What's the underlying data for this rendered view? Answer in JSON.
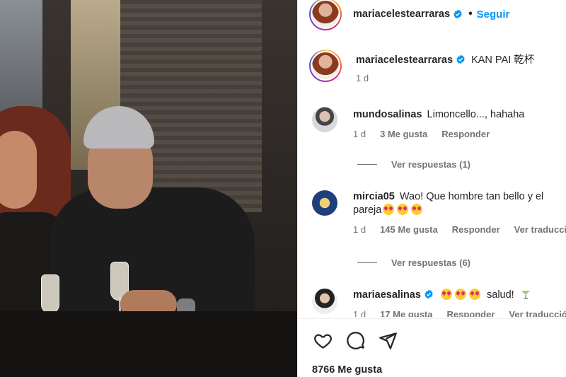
{
  "post": {
    "author": "mariacelestearraras",
    "follow_label": "Seguir",
    "dot": "•",
    "caption": {
      "username": "mariacelestearraras",
      "text": "KAN PAI 乾杯",
      "time": "1 d"
    },
    "likes": "8766 Me gusta"
  },
  "comments": [
    {
      "username": "mundosalinas",
      "text": "Limoncello..., hahaha",
      "time": "1 d",
      "likes": "3 Me gusta",
      "reply": "Responder",
      "view_replies": "Ver respuestas (1)"
    },
    {
      "username": "mircia05",
      "text_line1": "Wao! Que hombre tan bello y el",
      "text_line2": "pareja",
      "time": "1 d",
      "likes": "145 Me gusta",
      "reply": "Responder",
      "translate": "Ver traducción",
      "view_replies": "Ver respuestas (6)"
    },
    {
      "username": "mariaesalinas",
      "text": "salud!",
      "time": "1 d",
      "likes": "17 Me gusta",
      "reply": "Responder",
      "translate": "Ver traducción"
    }
  ],
  "icons": [
    "heart-icon",
    "comment-icon",
    "share-icon",
    "verified-icon"
  ],
  "colors": {
    "accent": "#0095f6",
    "verified": "#0095f6",
    "muted": "#737373"
  }
}
